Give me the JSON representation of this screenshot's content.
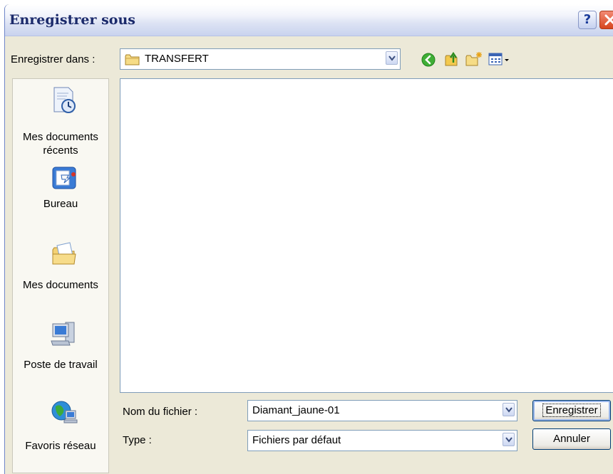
{
  "window": {
    "title": "Enregistrer sous"
  },
  "titlebar": {
    "help_label": "?"
  },
  "location": {
    "label": "Enregistrer dans :",
    "current_folder": "TRANSFERT"
  },
  "toolbar": {
    "icons": [
      "back-icon",
      "up-folder-icon",
      "new-folder-icon",
      "view-menu-icon"
    ]
  },
  "places": [
    {
      "label": "Mes documents récents",
      "icon": "recent-documents-icon"
    },
    {
      "label": "Bureau",
      "icon": "desktop-icon"
    },
    {
      "label": "Mes documents",
      "icon": "my-documents-icon"
    },
    {
      "label": "Poste de travail",
      "icon": "my-computer-icon"
    },
    {
      "label": "Favoris réseau",
      "icon": "network-places-icon"
    }
  ],
  "filename": {
    "label": "Nom du fichier :",
    "value": "Diamant_jaune-01"
  },
  "filetype": {
    "label": "Type :",
    "value": "Fichiers par défaut"
  },
  "buttons": {
    "save_label": "Enregistrer",
    "cancel_label": "Annuler"
  },
  "colors": {
    "dialog_bg": "#ece9d8",
    "title_text": "#1b2a6b",
    "close_button": "#d6451e",
    "places_bg": "#f9f8f2"
  }
}
